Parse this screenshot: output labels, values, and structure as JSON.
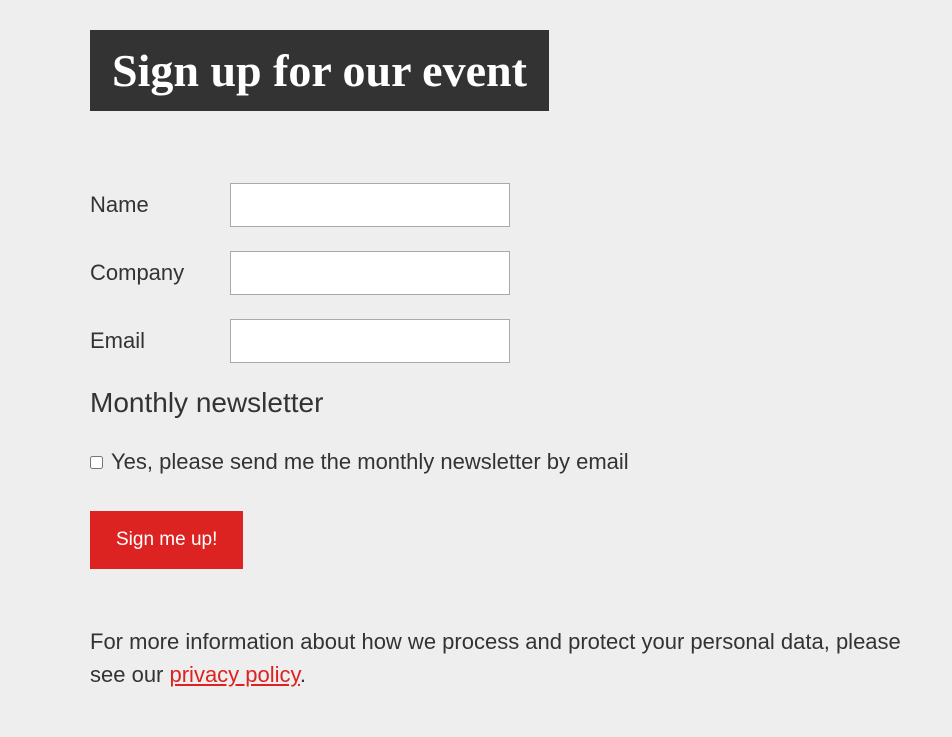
{
  "header": {
    "title": "Sign up for our event"
  },
  "form": {
    "fields": {
      "name": {
        "label": "Name",
        "value": ""
      },
      "company": {
        "label": "Company",
        "value": ""
      },
      "email": {
        "label": "Email",
        "value": ""
      }
    },
    "newsletter": {
      "heading": "Monthly newsletter",
      "checkbox_label": "Yes, please send me the monthly newsletter by email"
    },
    "submit_label": "Sign me up!"
  },
  "footer": {
    "text_before": "For more information about how we process and protect your personal data, please see our ",
    "link_text": "privacy policy",
    "text_after": "."
  }
}
